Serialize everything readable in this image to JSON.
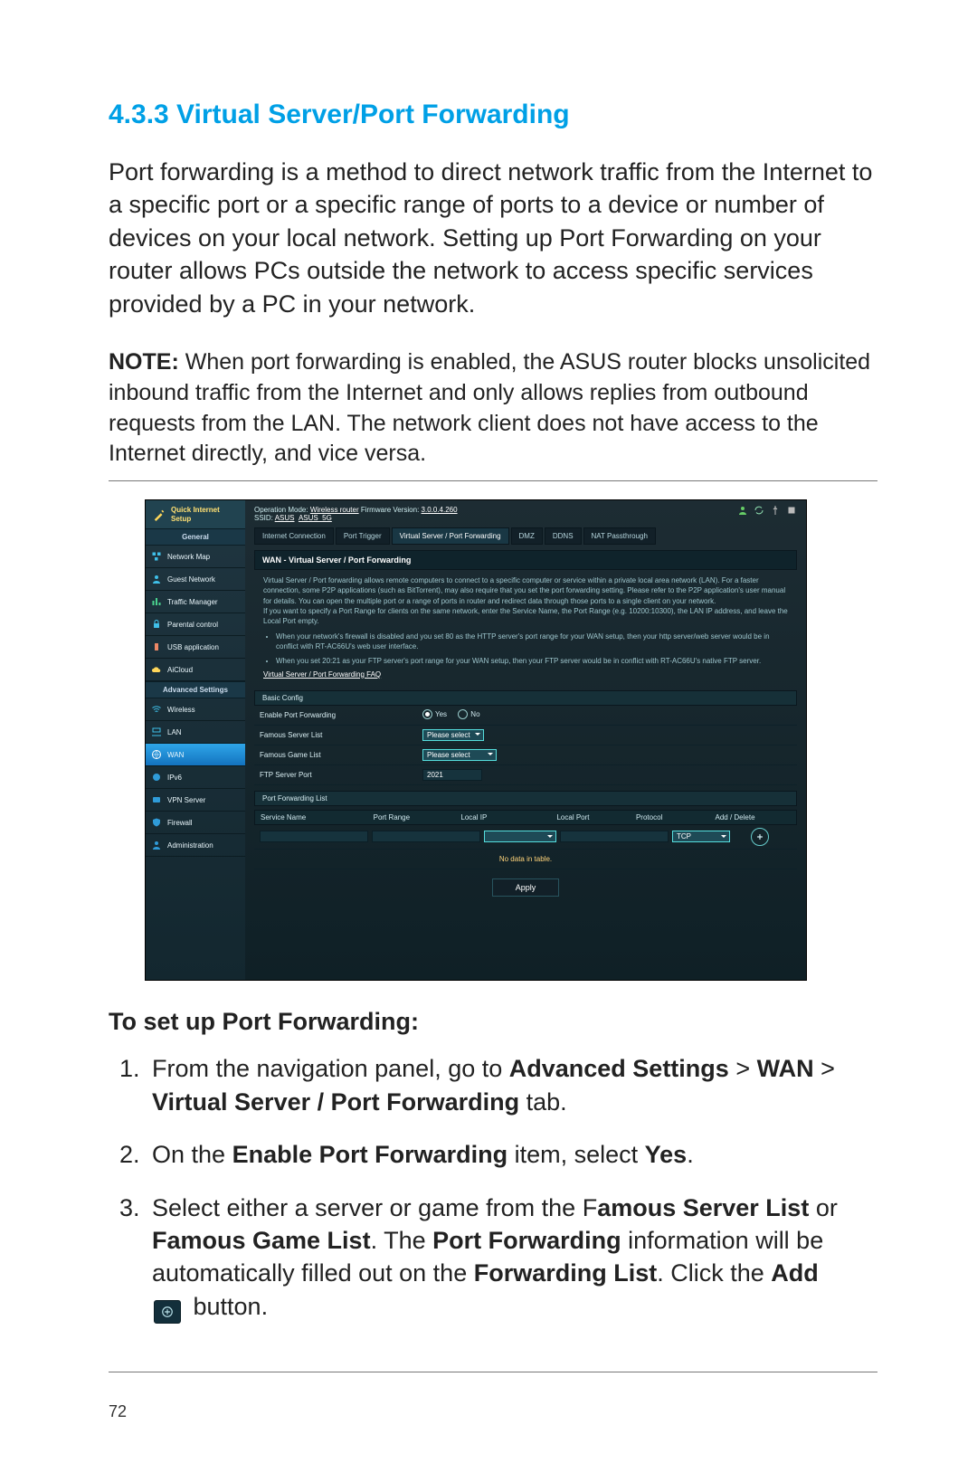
{
  "page_number": "72",
  "section": {
    "title": "4.3.3  Virtual Server/Port Forwarding",
    "intro": "Port forwarding is a method to direct network traffic from the Internet to a specific port or a specific range of ports to a device or number of devices on your local network. Setting up Port Forwarding on your router allows PCs outside the network to access specific services provided by a PC in your network.",
    "note_label": "NOTE:",
    "note_body": "  When port forwarding is enabled, the ASUS router blocks unsolicited inbound traffic from the Internet and only allows replies from outbound requests from the LAN. The network client does not have access to the Internet directly, and vice versa.",
    "subheading": "To set up Port Forwarding:",
    "steps": {
      "s1a": "From the navigation panel, go to ",
      "s1b": "Advanced Settings",
      "s1c": " > ",
      "s1d": "WAN",
      "s1e": " > ",
      "s1f": "Virtual Server / Port Forwarding",
      "s1g": " tab.",
      "s2a": "On the ",
      "s2b": "Enable Port Forwarding",
      "s2c": " item, select ",
      "s2d": "Yes",
      "s2e": ".",
      "s3a": "Select either a server or game from the F",
      "s3b": "amous Server List",
      "s3c": " or ",
      "s3d": "Famous Game List",
      "s3e": ". The ",
      "s3f": "Port Forwarding",
      "s3g": " information will be automatically filled out on the ",
      "s3h": "Forwarding List",
      "s3i": ". Click the ",
      "s3j": "Add",
      "s3k": " button."
    }
  },
  "router": {
    "qis": "Quick Internet Setup",
    "nav_general": "General",
    "nav": [
      "Network Map",
      "Guest Network",
      "Traffic Manager",
      "Parental control",
      "USB application",
      "AiCloud"
    ],
    "nav_adv_head": "Advanced Settings",
    "nav_adv": [
      "Wireless",
      "LAN",
      "WAN",
      "IPv6",
      "VPN Server",
      "Firewall",
      "Administration"
    ],
    "top": {
      "op_mode_label": "Operation Mode: ",
      "op_mode": "Wireless router",
      "fw_label": "   Firmware Version: ",
      "fw": "3.0.0.4.260",
      "ssid_label": "SSID: ",
      "ssid1": "ASUS",
      "ssid2": "ASUS_5G"
    },
    "tabs": [
      "Internet Connection",
      "Port Trigger",
      "Virtual Server / Port Forwarding",
      "DMZ",
      "DDNS",
      "NAT Passthrough"
    ],
    "section_title": "WAN - Virtual Server / Port Forwarding",
    "desc": {
      "p": "Virtual Server / Port forwarding allows remote computers to connect to a specific computer or service within a private local area network (LAN). For a faster connection, some P2P applications (such as BitTorrent), may also require that you set the port forwarding setting. Please refer to the P2P application's user manual for details. You can open the multiple port or a range of ports in router and redirect data through those ports to a single client on your network.\nIf you want to specify a Port Range for clients on the same network, enter the Service Name, the Port Range (e.g. 10200:10300), the LAN IP address, and leave the Local Port empty.",
      "b1": "When your network's firewall is disabled and you set 80 as the HTTP server's port range for your WAN setup, then your http server/web server would be in conflict with RT-AC66U's web user interface.",
      "b2": "When you set 20:21 as your FTP server's port range for your WAN setup, then your FTP server would be in conflict with RT-AC66U's native FTP server.",
      "faq": "Virtual Server / Port Forwarding FAQ"
    },
    "basic": {
      "head": "Basic Config",
      "row1": "Enable Port Forwarding",
      "row1_yes": "Yes",
      "row1_no": "No",
      "row2": "Famous Server List",
      "row2_val": "Please select",
      "row3": "Famous Game List",
      "row3_val": "Please select",
      "row4": "FTP Server Port",
      "row4_val": "2021"
    },
    "pf": {
      "head": "Port Forwarding List",
      "cols": [
        "Service Name",
        "Port Range",
        "Local IP",
        "Local Port",
        "Protocol",
        "Add / Delete"
      ],
      "proto": "TCP",
      "nodata": "No data in table.",
      "apply": "Apply"
    }
  }
}
